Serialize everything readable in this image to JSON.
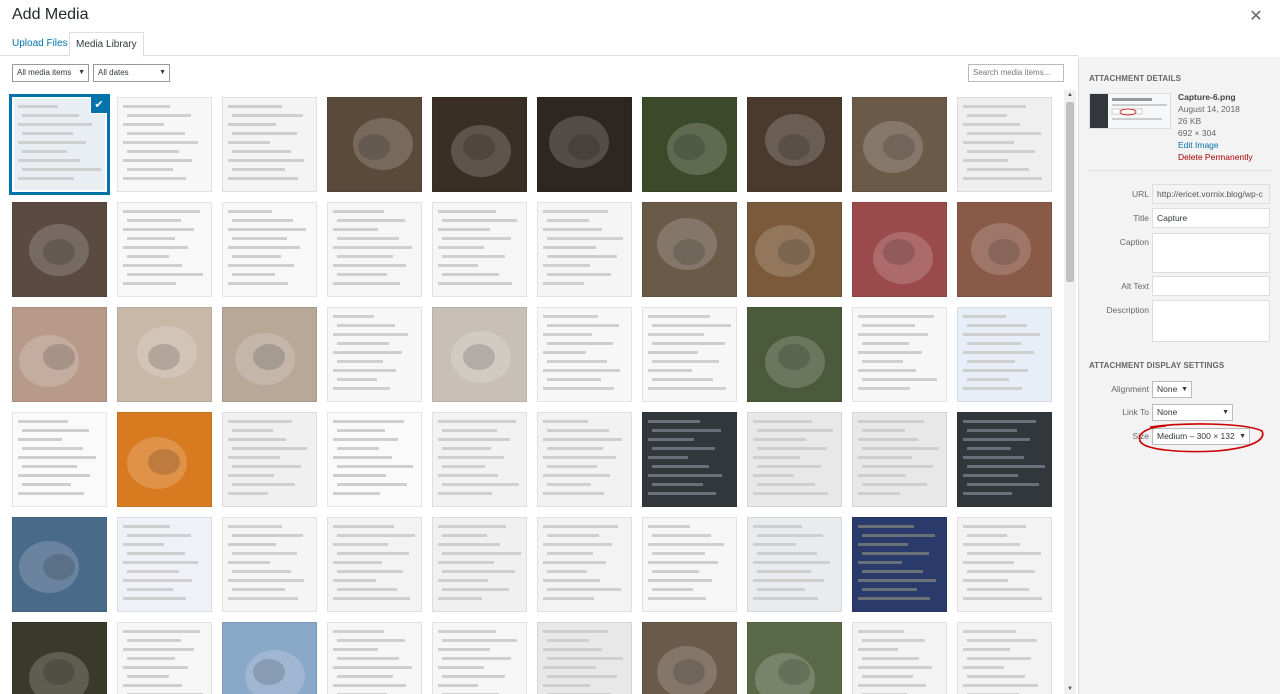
{
  "header": {
    "title": "Add Media",
    "close_icon": "close-icon"
  },
  "tabs": [
    {
      "label": "Upload Files",
      "active": false
    },
    {
      "label": "Media Library",
      "active": true
    }
  ],
  "toolbar": {
    "type_filter": "All media items",
    "date_filter": "All dates",
    "search_placeholder": "Search media items..."
  },
  "grid": {
    "selected_index": 0,
    "items": [
      {
        "kind": "screenshot",
        "color": "#e8eef4",
        "label": "Capture-6.png",
        "selected": true
      },
      {
        "kind": "screenshot",
        "color": "#f7f7f7"
      },
      {
        "kind": "screenshot",
        "color": "#f4f4f4"
      },
      {
        "kind": "photo",
        "color": "#5a4a3a"
      },
      {
        "kind": "photo",
        "color": "#3a2f24"
      },
      {
        "kind": "photo",
        "color": "#2e2620"
      },
      {
        "kind": "photo",
        "color": "#3c4a2a"
      },
      {
        "kind": "photo",
        "color": "#4a3a2e"
      },
      {
        "kind": "photo",
        "color": "#6b5a48"
      },
      {
        "kind": "screenshot",
        "color": "#efefef"
      },
      {
        "kind": "photo",
        "color": "#5a4a40"
      },
      {
        "kind": "screenshot",
        "color": "#f8f8f8"
      },
      {
        "kind": "screenshot",
        "color": "#f8f8f8"
      },
      {
        "kind": "screenshot",
        "color": "#f6f6f6"
      },
      {
        "kind": "screenshot",
        "color": "#f6f6f6"
      },
      {
        "kind": "screenshot",
        "color": "#f5f5f5"
      },
      {
        "kind": "photo",
        "color": "#6a5a48"
      },
      {
        "kind": "photo",
        "color": "#7a5a3a"
      },
      {
        "kind": "photo",
        "color": "#9a4a4a"
      },
      {
        "kind": "photo",
        "color": "#8a5a48"
      },
      {
        "kind": "photo",
        "color": "#b89a8a"
      },
      {
        "kind": "photo",
        "color": "#c8b8a8"
      },
      {
        "kind": "photo",
        "color": "#b8a898"
      },
      {
        "kind": "screenshot",
        "color": "#f7f7f7"
      },
      {
        "kind": "photo",
        "color": "#c8c0b8"
      },
      {
        "kind": "screenshot",
        "color": "#f7f7f7"
      },
      {
        "kind": "screenshot",
        "color": "#f7f7f7"
      },
      {
        "kind": "photo",
        "color": "#4a5a3a"
      },
      {
        "kind": "screenshot",
        "color": "#f7f7f7"
      },
      {
        "kind": "screenshot",
        "color": "#e8eef8"
      },
      {
        "kind": "screenshot",
        "color": "#fafafa"
      },
      {
        "kind": "photo",
        "color": "#d87a20"
      },
      {
        "kind": "screenshot",
        "color": "#f0f0f0"
      },
      {
        "kind": "screenshot",
        "color": "#fafafa"
      },
      {
        "kind": "screenshot",
        "color": "#f2f2f2"
      },
      {
        "kind": "screenshot",
        "color": "#f2f2f2"
      },
      {
        "kind": "screenshot",
        "color": "#32373c"
      },
      {
        "kind": "screenshot",
        "color": "#e8e8e8"
      },
      {
        "kind": "screenshot",
        "color": "#e8e8e8"
      },
      {
        "kind": "screenshot",
        "color": "#32373c"
      },
      {
        "kind": "photo",
        "color": "#4a6a8a"
      },
      {
        "kind": "screenshot",
        "color": "#eef2f8"
      },
      {
        "kind": "screenshot",
        "color": "#f5f5f5"
      },
      {
        "kind": "screenshot",
        "color": "#f3f3f3"
      },
      {
        "kind": "screenshot",
        "color": "#f0f0f0"
      },
      {
        "kind": "screenshot",
        "color": "#f3f3f3"
      },
      {
        "kind": "screenshot",
        "color": "#f6f6f6"
      },
      {
        "kind": "screenshot",
        "color": "#e8ecef"
      },
      {
        "kind": "screenshot",
        "color": "#2a3a6a"
      },
      {
        "kind": "screenshot",
        "color": "#f3f3f3"
      },
      {
        "kind": "photo",
        "color": "#3a3a2a"
      },
      {
        "kind": "screenshot",
        "color": "#f6f6f6"
      },
      {
        "kind": "photo",
        "color": "#8aa8c8"
      },
      {
        "kind": "screenshot",
        "color": "#f6f6f6"
      },
      {
        "kind": "screenshot",
        "color": "#f6f6f6"
      },
      {
        "kind": "screenshot",
        "color": "#e8e8e8"
      },
      {
        "kind": "photo",
        "color": "#6a5a4a"
      },
      {
        "kind": "photo",
        "color": "#5a6a48"
      },
      {
        "kind": "screenshot",
        "color": "#f3f3f3"
      },
      {
        "kind": "screenshot",
        "color": "#f3f3f3"
      }
    ]
  },
  "sidebar": {
    "details_heading": "ATTACHMENT DETAILS",
    "filename": "Capture-6.png",
    "date": "August 14, 2018",
    "filesize": "26 KB",
    "dimensions": "692 × 304",
    "edit_link": "Edit Image",
    "delete_link": "Delete Permanently",
    "url_label": "URL",
    "url_value": "http://ericet.vornix.blog/wp-c",
    "title_label": "Title",
    "title_value": "Capture",
    "caption_label": "Caption",
    "caption_value": "",
    "alt_label": "Alt Text",
    "alt_value": "",
    "description_label": "Description",
    "description_value": "",
    "display_heading": "ATTACHMENT DISPLAY SETTINGS",
    "alignment_label": "Alignment",
    "alignment_value": "None",
    "link_label": "Link To",
    "link_value": "None",
    "size_label": "Size",
    "size_value": "Medium – 300 × 132"
  },
  "colors": {
    "accent": "#0073aa",
    "danger": "#a00",
    "annotation": "#cc0000"
  }
}
